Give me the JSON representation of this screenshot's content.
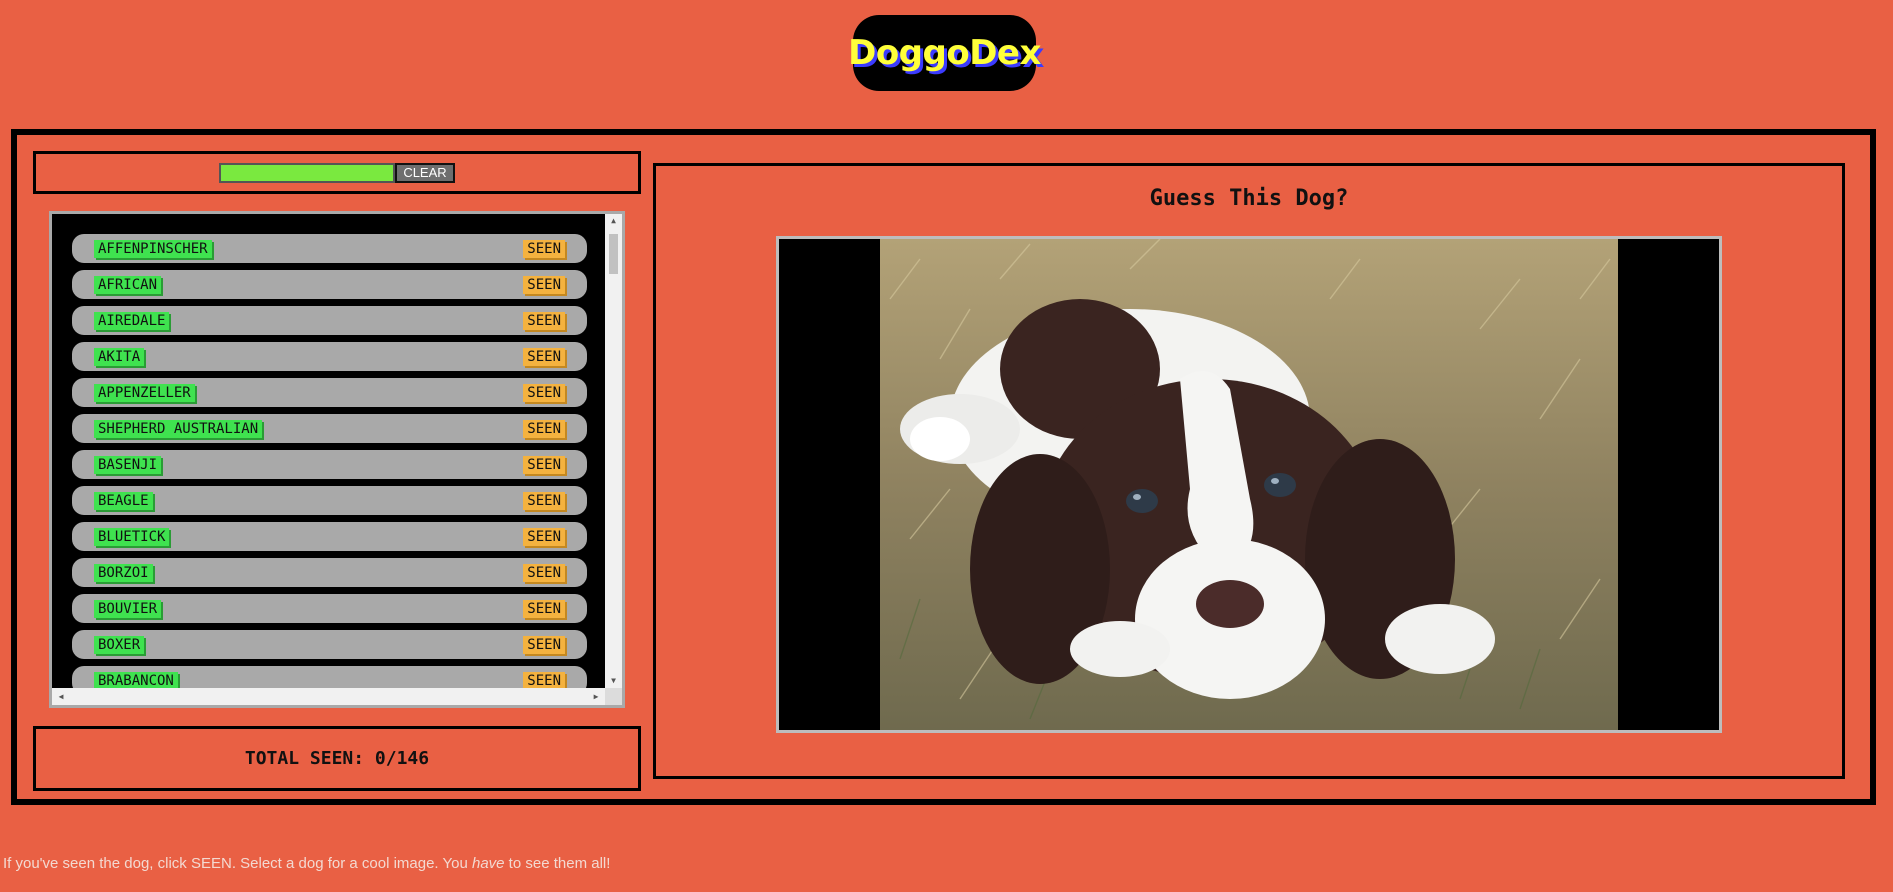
{
  "app": {
    "title": "DoggoDex"
  },
  "search": {
    "value": "",
    "placeholder": "",
    "clear_label": "CLEAR"
  },
  "dogs": [
    {
      "name": "AFFENPINSCHER",
      "action": "SEEN"
    },
    {
      "name": "AFRICAN",
      "action": "SEEN"
    },
    {
      "name": "AIREDALE",
      "action": "SEEN"
    },
    {
      "name": "AKITA",
      "action": "SEEN"
    },
    {
      "name": "APPENZELLER",
      "action": "SEEN"
    },
    {
      "name": "SHEPHERD AUSTRALIAN",
      "action": "SEEN"
    },
    {
      "name": "BASENJI",
      "action": "SEEN"
    },
    {
      "name": "BEAGLE",
      "action": "SEEN"
    },
    {
      "name": "BLUETICK",
      "action": "SEEN"
    },
    {
      "name": "BORZOI",
      "action": "SEEN"
    },
    {
      "name": "BOUVIER",
      "action": "SEEN"
    },
    {
      "name": "BOXER",
      "action": "SEEN"
    },
    {
      "name": "BRABANCON",
      "action": "SEEN"
    }
  ],
  "total": {
    "text": "TOTAL SEEN: 0/146"
  },
  "guess": {
    "title": "Guess This Dog?"
  },
  "footer": {
    "before": "If you've seen the dog, click SEEN. Select a dog for a cool image. You ",
    "emphasis": "have",
    "after": " to see them all!"
  },
  "colors": {
    "background": "#e96044",
    "name_badge": "#3fe24f",
    "seen_badge": "#f4b23f",
    "logo_text": "#ffff3a",
    "logo_shadow": "#3b3bff"
  }
}
